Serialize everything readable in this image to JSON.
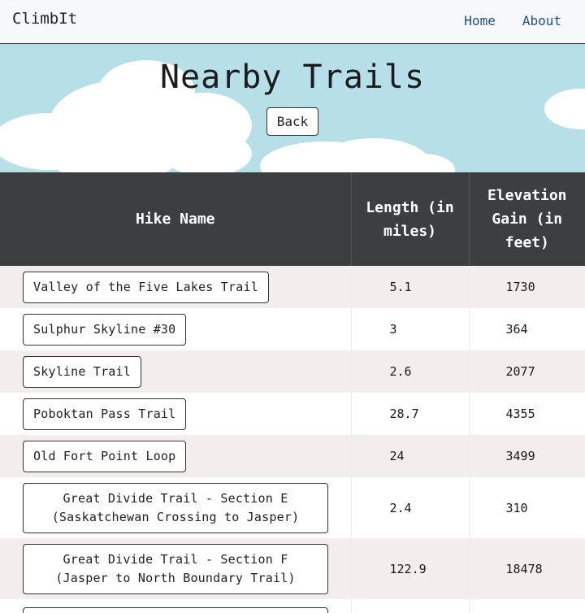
{
  "nav": {
    "brand": "ClimbIt",
    "links": [
      "Home",
      "About"
    ]
  },
  "hero": {
    "title": "Nearby Trails",
    "back_label": "Back"
  },
  "table": {
    "headers": [
      "Hike Name",
      "Length (in miles)",
      "Elevation Gain (in feet)"
    ],
    "rows": [
      {
        "name": "Valley of the Five Lakes Trail",
        "length": "5.1",
        "elevation": "1730"
      },
      {
        "name": "Sulphur Skyline #30",
        "length": "3",
        "elevation": "364"
      },
      {
        "name": "Skyline Trail",
        "length": "2.6",
        "elevation": "2077"
      },
      {
        "name": "Poboktan Pass Trail",
        "length": "28.7",
        "elevation": "4355"
      },
      {
        "name": "Old Fort Point Loop",
        "length": "24",
        "elevation": "3499"
      },
      {
        "name": "Great Divide Trail - Section E (Saskatchewan Crossing to Jasper)",
        "length": "2.4",
        "elevation": "310"
      },
      {
        "name": "Great Divide Trail - Section F (Jasper to North Boundary Trail)",
        "length": "122.9",
        "elevation": "18478"
      }
    ]
  },
  "colors": {
    "header_bg": "#3d3e40",
    "row_alt_bg": "#f3eded",
    "sky": "#b6dfe8",
    "link": "#1f4f8a"
  }
}
